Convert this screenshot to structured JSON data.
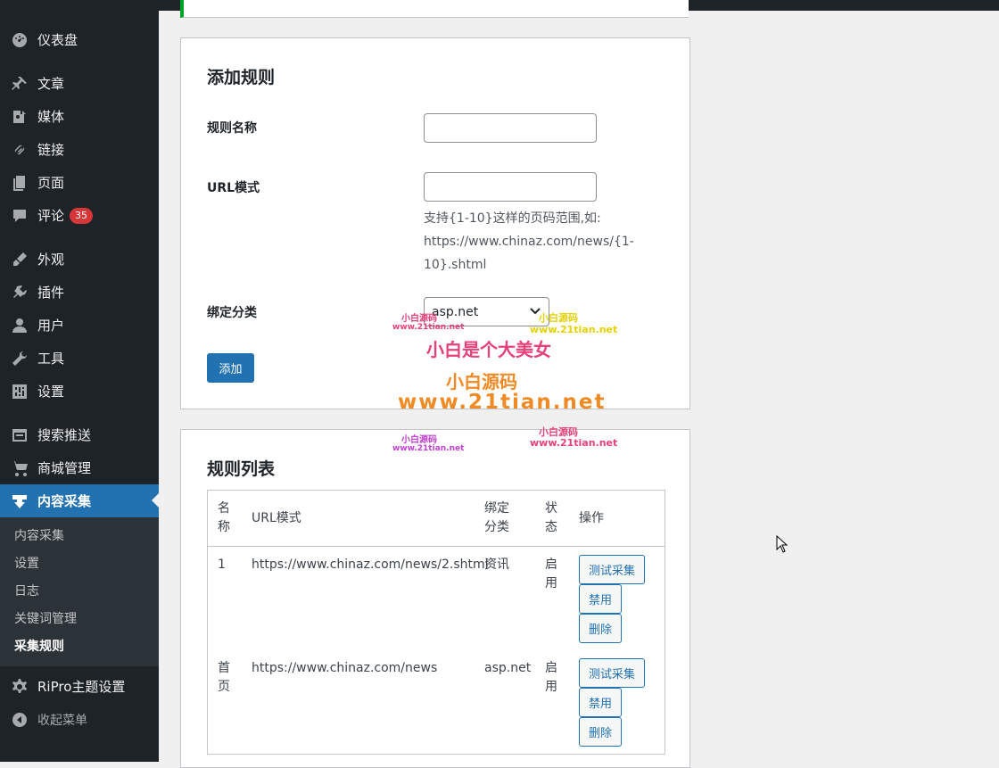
{
  "sidebar": {
    "items": [
      {
        "label": "仪表盘",
        "icon": "dashboard-icon"
      },
      {
        "label": "文章",
        "icon": "pin-icon"
      },
      {
        "label": "媒体",
        "icon": "media-icon"
      },
      {
        "label": "链接",
        "icon": "link-icon"
      },
      {
        "label": "页面",
        "icon": "page-icon"
      },
      {
        "label": "评论",
        "icon": "comment-icon",
        "badge": "35"
      },
      {
        "label": "外观",
        "icon": "brush-icon"
      },
      {
        "label": "插件",
        "icon": "plugin-icon"
      },
      {
        "label": "用户",
        "icon": "user-icon"
      },
      {
        "label": "工具",
        "icon": "wrench-icon"
      },
      {
        "label": "设置",
        "icon": "settings-icon"
      },
      {
        "label": "搜索推送",
        "icon": "push-icon"
      },
      {
        "label": "商城管理",
        "icon": "cart-icon"
      },
      {
        "label": "内容采集",
        "icon": "download-icon"
      }
    ],
    "submenu": [
      "内容采集",
      "设置",
      "日志",
      "关键词管理",
      "采集规则"
    ],
    "ripro": "RiPro主题设置",
    "collapse": "收起菜单"
  },
  "add_rule": {
    "title": "添加规则",
    "name_label": "规则名称",
    "url_label": "URL模式",
    "url_help": "支持{1-10}这样的页码范围,如: https://www.chinaz.com/news/{1-10}.shtml",
    "category_label": "绑定分类",
    "category_value": "asp.net",
    "submit": "添加"
  },
  "rule_list": {
    "title": "规则列表",
    "headers": [
      "名称",
      "URL模式",
      "绑定分类",
      "状态",
      "操作"
    ],
    "rows": [
      {
        "name": "1",
        "url": "https://www.chinaz.com/news/2.shtml",
        "category": "资讯",
        "status": "启用"
      },
      {
        "name": "首页",
        "url": "https://www.chinaz.com/news",
        "category": "asp.net",
        "status": "启用"
      }
    ],
    "actions": [
      "测试采集",
      "禁用",
      "删除"
    ]
  },
  "watermark": {
    "line1": "小白是个大美女",
    "line2": "小白源码",
    "line3": "www.21tian.net",
    "small1": "小白源码",
    "small2": "www.21tian.net"
  },
  "colors": {
    "accent": "#2271b1",
    "sidebar": "#1d2327",
    "badge": "#d63638"
  }
}
